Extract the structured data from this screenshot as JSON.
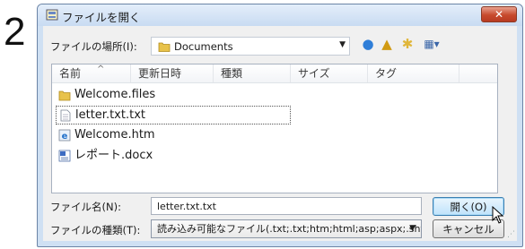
{
  "step_number": "2",
  "dialog": {
    "title": "ファイルを開く",
    "close_label": "✕"
  },
  "location": {
    "label": "ファイルの場所(I):",
    "value": "Documents"
  },
  "file_list": {
    "columns": [
      "名前",
      "更新日時",
      "種類",
      "サイズ",
      "タグ"
    ],
    "sort_indicator": "^",
    "items": [
      {
        "name": "Welcome.files",
        "icon": "folder-icon",
        "selected": false
      },
      {
        "name": "letter.txt.txt",
        "icon": "text-file-icon",
        "selected": true
      },
      {
        "name": "Welcome.htm",
        "icon": "html-file-icon",
        "selected": false
      },
      {
        "name": "レポート.docx",
        "icon": "word-doc-icon",
        "selected": false
      }
    ]
  },
  "filename": {
    "label": "ファイル名(N):",
    "value": "letter.txt.txt"
  },
  "filetype": {
    "label": "ファイルの種類(T):",
    "value": "読み込み可能なファイル(.txt;.txt;htm;html;asp;aspx;.sht"
  },
  "buttons": {
    "open": "開く(O)",
    "cancel": "キャンセル"
  }
}
